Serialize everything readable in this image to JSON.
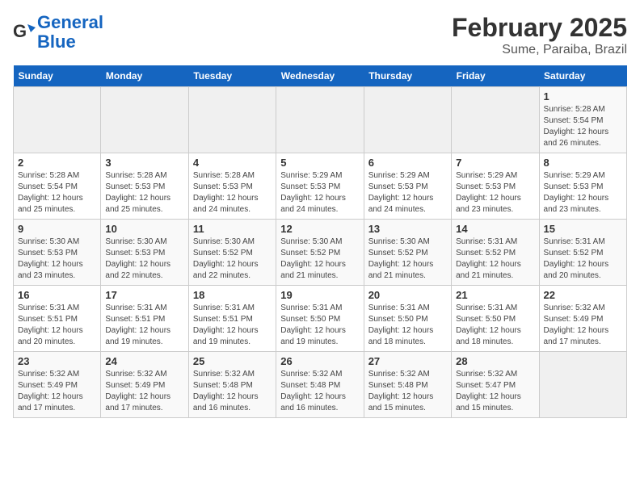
{
  "header": {
    "logo_line1": "General",
    "logo_line2": "Blue",
    "title": "February 2025",
    "subtitle": "Sume, Paraiba, Brazil"
  },
  "days_of_week": [
    "Sunday",
    "Monday",
    "Tuesday",
    "Wednesday",
    "Thursday",
    "Friday",
    "Saturday"
  ],
  "weeks": [
    [
      {
        "day": "",
        "info": ""
      },
      {
        "day": "",
        "info": ""
      },
      {
        "day": "",
        "info": ""
      },
      {
        "day": "",
        "info": ""
      },
      {
        "day": "",
        "info": ""
      },
      {
        "day": "",
        "info": ""
      },
      {
        "day": "1",
        "info": "Sunrise: 5:28 AM\nSunset: 5:54 PM\nDaylight: 12 hours and 26 minutes."
      }
    ],
    [
      {
        "day": "2",
        "info": "Sunrise: 5:28 AM\nSunset: 5:54 PM\nDaylight: 12 hours and 25 minutes."
      },
      {
        "day": "3",
        "info": "Sunrise: 5:28 AM\nSunset: 5:53 PM\nDaylight: 12 hours and 25 minutes."
      },
      {
        "day": "4",
        "info": "Sunrise: 5:28 AM\nSunset: 5:53 PM\nDaylight: 12 hours and 24 minutes."
      },
      {
        "day": "5",
        "info": "Sunrise: 5:29 AM\nSunset: 5:53 PM\nDaylight: 12 hours and 24 minutes."
      },
      {
        "day": "6",
        "info": "Sunrise: 5:29 AM\nSunset: 5:53 PM\nDaylight: 12 hours and 24 minutes."
      },
      {
        "day": "7",
        "info": "Sunrise: 5:29 AM\nSunset: 5:53 PM\nDaylight: 12 hours and 23 minutes."
      },
      {
        "day": "8",
        "info": "Sunrise: 5:29 AM\nSunset: 5:53 PM\nDaylight: 12 hours and 23 minutes."
      }
    ],
    [
      {
        "day": "9",
        "info": "Sunrise: 5:30 AM\nSunset: 5:53 PM\nDaylight: 12 hours and 23 minutes."
      },
      {
        "day": "10",
        "info": "Sunrise: 5:30 AM\nSunset: 5:53 PM\nDaylight: 12 hours and 22 minutes."
      },
      {
        "day": "11",
        "info": "Sunrise: 5:30 AM\nSunset: 5:52 PM\nDaylight: 12 hours and 22 minutes."
      },
      {
        "day": "12",
        "info": "Sunrise: 5:30 AM\nSunset: 5:52 PM\nDaylight: 12 hours and 21 minutes."
      },
      {
        "day": "13",
        "info": "Sunrise: 5:30 AM\nSunset: 5:52 PM\nDaylight: 12 hours and 21 minutes."
      },
      {
        "day": "14",
        "info": "Sunrise: 5:31 AM\nSunset: 5:52 PM\nDaylight: 12 hours and 21 minutes."
      },
      {
        "day": "15",
        "info": "Sunrise: 5:31 AM\nSunset: 5:52 PM\nDaylight: 12 hours and 20 minutes."
      }
    ],
    [
      {
        "day": "16",
        "info": "Sunrise: 5:31 AM\nSunset: 5:51 PM\nDaylight: 12 hours and 20 minutes."
      },
      {
        "day": "17",
        "info": "Sunrise: 5:31 AM\nSunset: 5:51 PM\nDaylight: 12 hours and 19 minutes."
      },
      {
        "day": "18",
        "info": "Sunrise: 5:31 AM\nSunset: 5:51 PM\nDaylight: 12 hours and 19 minutes."
      },
      {
        "day": "19",
        "info": "Sunrise: 5:31 AM\nSunset: 5:50 PM\nDaylight: 12 hours and 19 minutes."
      },
      {
        "day": "20",
        "info": "Sunrise: 5:31 AM\nSunset: 5:50 PM\nDaylight: 12 hours and 18 minutes."
      },
      {
        "day": "21",
        "info": "Sunrise: 5:31 AM\nSunset: 5:50 PM\nDaylight: 12 hours and 18 minutes."
      },
      {
        "day": "22",
        "info": "Sunrise: 5:32 AM\nSunset: 5:49 PM\nDaylight: 12 hours and 17 minutes."
      }
    ],
    [
      {
        "day": "23",
        "info": "Sunrise: 5:32 AM\nSunset: 5:49 PM\nDaylight: 12 hours and 17 minutes."
      },
      {
        "day": "24",
        "info": "Sunrise: 5:32 AM\nSunset: 5:49 PM\nDaylight: 12 hours and 17 minutes."
      },
      {
        "day": "25",
        "info": "Sunrise: 5:32 AM\nSunset: 5:48 PM\nDaylight: 12 hours and 16 minutes."
      },
      {
        "day": "26",
        "info": "Sunrise: 5:32 AM\nSunset: 5:48 PM\nDaylight: 12 hours and 16 minutes."
      },
      {
        "day": "27",
        "info": "Sunrise: 5:32 AM\nSunset: 5:48 PM\nDaylight: 12 hours and 15 minutes."
      },
      {
        "day": "28",
        "info": "Sunrise: 5:32 AM\nSunset: 5:47 PM\nDaylight: 12 hours and 15 minutes."
      },
      {
        "day": "",
        "info": ""
      }
    ]
  ]
}
